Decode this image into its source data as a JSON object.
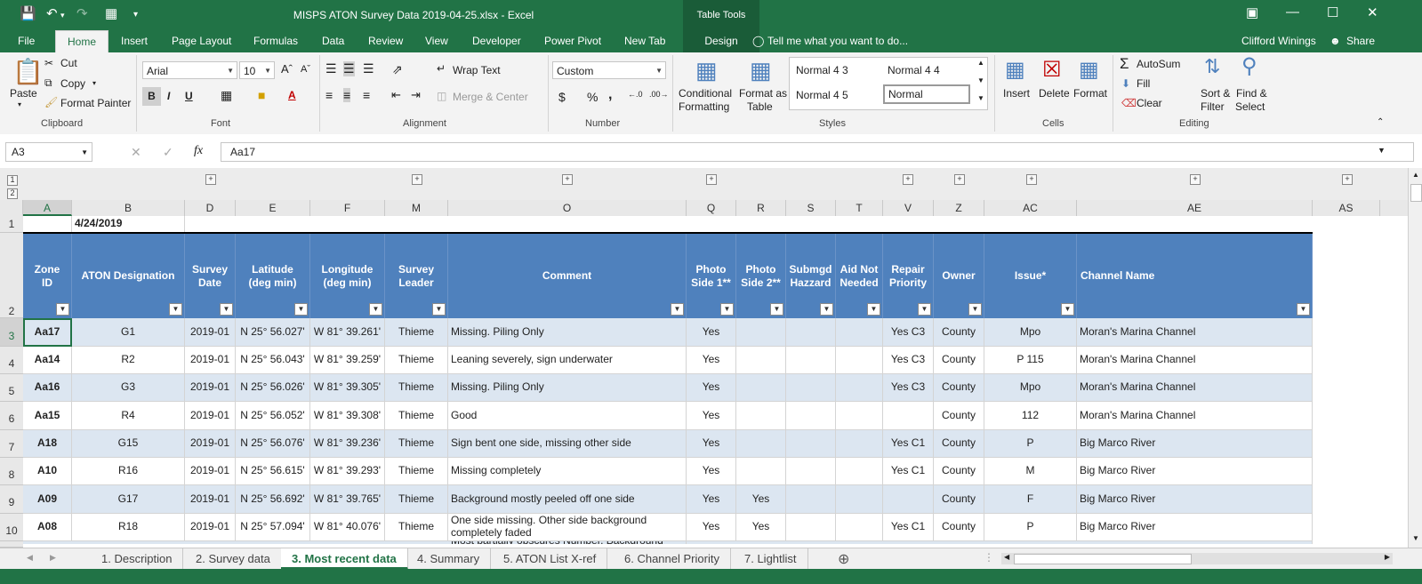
{
  "window": {
    "title": "MISPS ATON Survey Data 2019-04-25.xlsx - Excel",
    "table_tools": "Table Tools",
    "user": "Clifford Winings",
    "share": "Share"
  },
  "ribbon_tabs": [
    "File",
    "Home",
    "Insert",
    "Page Layout",
    "Formulas",
    "Data",
    "Review",
    "View",
    "Developer",
    "Power Pivot",
    "New Tab",
    "Design"
  ],
  "tell_me": "Tell me what you want to do...",
  "clipboard": {
    "paste": "Paste",
    "cut": "Cut",
    "copy": "Copy",
    "format_painter": "Format Painter",
    "group": "Clipboard"
  },
  "font": {
    "name": "Arial",
    "size": "10",
    "group": "Font",
    "bold": "B",
    "italic": "I",
    "underline": "U"
  },
  "alignment": {
    "wrap": "Wrap Text",
    "merge": "Merge & Center",
    "group": "Alignment"
  },
  "number": {
    "format": "Custom",
    "group": "Number",
    "currency": "$",
    "percent": "%",
    "comma": ","
  },
  "styles": {
    "conditional": "Conditional",
    "formatting": "Formatting",
    "format_as": "Format as",
    "table": "Table",
    "s1": "Normal 4 3",
    "s2": "Normal 4 4",
    "s3": "Normal 4 5",
    "s4": "Normal",
    "group": "Styles"
  },
  "cells": {
    "insert": "Insert",
    "delete": "Delete",
    "format": "Format",
    "group": "Cells"
  },
  "editing": {
    "autosum": "AutoSum",
    "fill": "Fill",
    "clear": "Clear",
    "sort": "Sort &",
    "filter": "Filter",
    "find": "Find &",
    "select": "Select",
    "group": "Editing"
  },
  "formula_bar": {
    "name_box": "A3",
    "fx": "fx",
    "value": "Aa17"
  },
  "outline_levels": [
    "1",
    "2"
  ],
  "columns": [
    "A",
    "B",
    "D",
    "E",
    "F",
    "M",
    "O",
    "Q",
    "R",
    "S",
    "T",
    "V",
    "Z",
    "AC",
    "AE",
    "AS"
  ],
  "row_numbers": [
    "1",
    "2",
    "3",
    "4",
    "5",
    "6",
    "7",
    "8",
    "9",
    "10"
  ],
  "date_cell": "4/24/2019",
  "headers": {
    "zone": "Zone ID",
    "aton": "ATON Designation",
    "survey_date": "Survey Date",
    "lat": "Latitude (deg min)",
    "lon": "Longitude (deg min)",
    "leader": "Survey Leader",
    "comment": "Comment",
    "p1": "Photo Side 1**",
    "p2": "Photo Side 2**",
    "submgd": "Submgd Hazzard",
    "aid": "Aid Not Needed",
    "repair": "Repair Priority",
    "owner": "Owner",
    "issue": "Issue*",
    "channel": "Channel Name"
  },
  "rows": [
    {
      "zone": "Aa17",
      "aton": "G1",
      "date": "2019-01",
      "lat": "N 25° 56.027'",
      "lon": "W 81° 39.261'",
      "leader": "Thieme",
      "comment": "Missing.  Piling Only",
      "p1": "Yes",
      "p2": "",
      "sub": "",
      "aid": "",
      "repair": "Yes C3",
      "owner": "County",
      "issue": "Mpo",
      "channel": "Moran's Marina Channel"
    },
    {
      "zone": "Aa14",
      "aton": "R2",
      "date": "2019-01",
      "lat": "N 25° 56.043'",
      "lon": "W 81° 39.259'",
      "leader": "Thieme",
      "comment": "Leaning severely, sign underwater",
      "p1": "Yes",
      "p2": "",
      "sub": "",
      "aid": "",
      "repair": "Yes C3",
      "owner": "County",
      "issue": "P  115",
      "channel": "Moran's Marina Channel"
    },
    {
      "zone": "Aa16",
      "aton": "G3",
      "date": "2019-01",
      "lat": "N 25° 56.026'",
      "lon": "W 81° 39.305'",
      "leader": "Thieme",
      "comment": "Missing.  Piling Only",
      "p1": "Yes",
      "p2": "",
      "sub": "",
      "aid": "",
      "repair": "Yes C3",
      "owner": "County",
      "issue": "Mpo",
      "channel": "Moran's Marina Channel"
    },
    {
      "zone": "Aa15",
      "aton": "R4",
      "date": "2019-01",
      "lat": "N 25° 56.052'",
      "lon": "W 81° 39.308'",
      "leader": "Thieme",
      "comment": "Good",
      "p1": "Yes",
      "p2": "",
      "sub": "",
      "aid": "",
      "repair": "",
      "owner": "County",
      "issue": "112",
      "channel": "Moran's Marina Channel"
    },
    {
      "zone": "A18",
      "aton": "G15",
      "date": "2019-01",
      "lat": "N 25° 56.076'",
      "lon": "W 81° 39.236'",
      "leader": "Thieme",
      "comment": "Sign bent one side, missing other side",
      "p1": "Yes",
      "p2": "",
      "sub": "",
      "aid": "",
      "repair": "Yes C1",
      "owner": "County",
      "issue": "P",
      "channel": "Big Marco River"
    },
    {
      "zone": "A10",
      "aton": "R16",
      "date": "2019-01",
      "lat": "N 25° 56.615'",
      "lon": "W 81° 39.293'",
      "leader": "Thieme",
      "comment": "Missing completely",
      "p1": "Yes",
      "p2": "",
      "sub": "",
      "aid": "",
      "repair": "Yes C1",
      "owner": "County",
      "issue": "M",
      "channel": "Big Marco River"
    },
    {
      "zone": "A09",
      "aton": "G17",
      "date": "2019-01",
      "lat": "N 25° 56.692'",
      "lon": "W 81° 39.765'",
      "leader": "Thieme",
      "comment": " Background mostly peeled off one side",
      "p1": "Yes",
      "p2": "Yes",
      "sub": "",
      "aid": "",
      "repair": "",
      "owner": "County",
      "issue": "F",
      "channel": "Big Marco River"
    },
    {
      "zone": "A08",
      "aton": "R18",
      "date": "2019-01",
      "lat": "N 25° 57.094'",
      "lon": "W 81° 40.076'",
      "leader": "Thieme",
      "comment": "One side missing. Other side background completely faded",
      "p1": "Yes",
      "p2": "Yes",
      "sub": "",
      "aid": "",
      "repair": "Yes C1",
      "owner": "County",
      "issue": "P",
      "channel": "Big Marco River"
    }
  ],
  "partial_row_comment": "Most partially obscures Number. Background",
  "sheet_tabs": [
    "1. Description",
    "2. Survey data",
    "3. Most recent data",
    "4. Summary",
    "5. ATON List X-ref",
    "6. Channel Priority",
    "7. Lightlist"
  ],
  "active_tab": "3. Most recent data"
}
